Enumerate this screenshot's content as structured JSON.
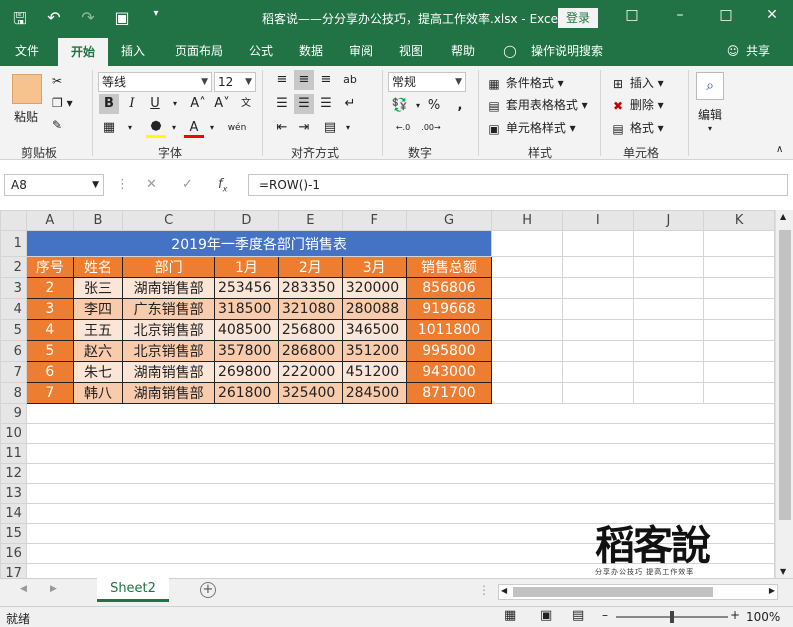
{
  "titlebar": {
    "title": "稻客说——分分享办公技巧，提高工作效率.xlsx  -  Excel",
    "login": "登录",
    "save_icon": "save-icon",
    "undo_icon": "undo-icon",
    "redo_icon": "redo-icon"
  },
  "tabs": [
    {
      "label": "文件"
    },
    {
      "label": "开始"
    },
    {
      "label": "插入"
    },
    {
      "label": "页面布局"
    },
    {
      "label": "公式"
    },
    {
      "label": "数据"
    },
    {
      "label": "审阅"
    },
    {
      "label": "视图"
    },
    {
      "label": "帮助"
    },
    {
      "label": "操作说明搜索"
    },
    {
      "label": "共享"
    }
  ],
  "ribbon": {
    "clipboard": {
      "paste": "粘贴",
      "label": "剪贴板"
    },
    "font": {
      "name": "等线",
      "size": "12",
      "label": "字体"
    },
    "alignment": {
      "label": "对齐方式"
    },
    "number": {
      "format": "常规",
      "label": "数字"
    },
    "styles": {
      "conditional": "条件格式",
      "table": "套用表格格式",
      "cell": "单元格样式",
      "label": "样式"
    },
    "cells": {
      "insert": "插入",
      "delete": "删除",
      "format": "格式",
      "label": "单元格"
    },
    "editing": {
      "label": "编辑"
    }
  },
  "formula_bar": {
    "name_box": "A8",
    "formula": "=ROW()-1"
  },
  "columns": [
    "A",
    "B",
    "C",
    "D",
    "E",
    "F",
    "G",
    "H",
    "I",
    "J",
    "K"
  ],
  "sheet": {
    "title": "2019年一季度各部门销售表",
    "headers": [
      "序号",
      "姓名",
      "部门",
      "1月",
      "2月",
      "3月",
      "销售总额"
    ],
    "rows": [
      [
        "2",
        "张三",
        "湖南销售部",
        "253456",
        "283350",
        "320000",
        "856806"
      ],
      [
        "3",
        "李四",
        "广东销售部",
        "318500",
        "321080",
        "280088",
        "919668"
      ],
      [
        "4",
        "王五",
        "北京销售部",
        "408500",
        "256800",
        "346500",
        "1011800"
      ],
      [
        "5",
        "赵六",
        "北京销售部",
        "357800",
        "286800",
        "351200",
        "995800"
      ],
      [
        "6",
        "朱七",
        "湖南销售部",
        "269800",
        "222000",
        "451200",
        "943000"
      ],
      [
        "7",
        "韩八",
        "湖南销售部",
        "261800",
        "325400",
        "284500",
        "871700"
      ]
    ],
    "row_numbers": [
      "1",
      "2",
      "3",
      "4",
      "5",
      "6",
      "7",
      "8",
      "9",
      "10",
      "11",
      "12",
      "13",
      "14",
      "15",
      "16",
      "17"
    ]
  },
  "sheet_tabs": [
    {
      "label": "Sheet2"
    }
  ],
  "status": {
    "ready": "就绪",
    "zoom": "100%"
  },
  "watermark": {
    "big": "稻客說",
    "small": "分享办公技巧 提高工作效率"
  }
}
